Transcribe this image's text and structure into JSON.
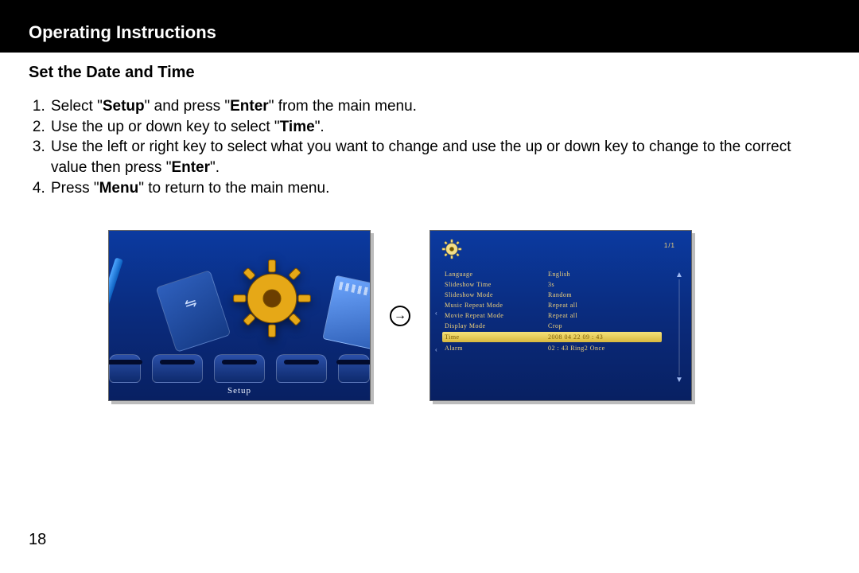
{
  "header": {
    "title": "Operating Instructions"
  },
  "section": {
    "heading": "Set the Date and Time"
  },
  "steps": {
    "s1a": "Select \"",
    "s1b": "Setup",
    "s1c": "\" and press \"",
    "s1d": "Enter",
    "s1e": "\" from the main menu.",
    "s2a": "Use the up or down key to select \"",
    "s2b": "Time",
    "s2c": "\".",
    "s3a": "Use the left or right key to select what you want to change and use the up or down key to change to the correct value then press \"",
    "s3b": "Enter",
    "s3c": "\".",
    "s4a": "Press \"",
    "s4b": "Menu",
    "s4c": "\" to return to the main menu."
  },
  "left_screenshot": {
    "setup_label": "Setup"
  },
  "right_screenshot": {
    "top_right": "1/1",
    "rows": [
      {
        "k": "Language",
        "v": "English"
      },
      {
        "k": "Slideshow Time",
        "v": "3s"
      },
      {
        "k": "Slideshow Mode",
        "v": "Random"
      },
      {
        "k": "Music Repeat Mode",
        "v": "Repeat all"
      },
      {
        "k": "Movie Repeat Mode",
        "v": "Repeat all"
      },
      {
        "k": "Display Mode",
        "v": "Crop"
      },
      {
        "k": "Time",
        "v": "2008  04  22   09 : 43"
      },
      {
        "k": "Alarm",
        "v": "02 : 43   Ring2   Once"
      }
    ],
    "highlight_index": 6
  },
  "page_number": "18"
}
